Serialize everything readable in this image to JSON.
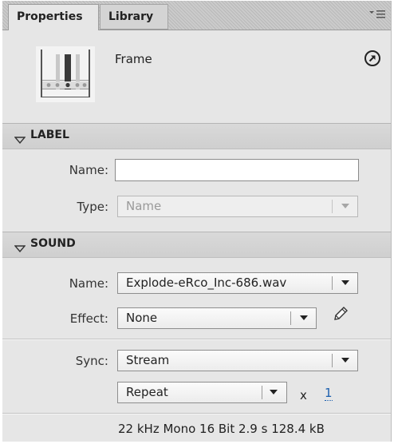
{
  "tabs": {
    "properties": "Properties",
    "library": "Library"
  },
  "header": {
    "title": "Frame"
  },
  "label_section": {
    "title": "LABEL",
    "name_label": "Name:",
    "name_value": "",
    "type_label": "Type:",
    "type_value": "Name"
  },
  "sound_section": {
    "title": "SOUND",
    "name_label": "Name:",
    "name_value": "Explode-eRco_Inc-686.wav",
    "effect_label": "Effect:",
    "effect_value": "None",
    "sync_label": "Sync:",
    "sync_value": "Stream",
    "repeat_value": "Repeat",
    "repeat_x": "x",
    "repeat_count": "1",
    "info": "22 kHz Mono 16 Bit 2.9 s 128.4 kB"
  },
  "icons": {
    "panel_menu": "panel-menu-icon",
    "help": "help-arrow-icon",
    "collapse": "triangle-down-icon",
    "edit": "pencil-icon",
    "dropdown": "chevron-down-icon"
  }
}
